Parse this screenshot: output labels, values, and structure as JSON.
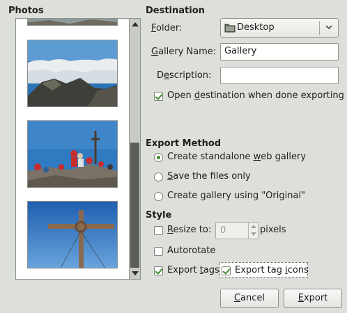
{
  "photos": {
    "title": "Photos",
    "thumbnails": [
      {
        "name": "mountain-trail-partial",
        "colors": {
          "sky": "#8e9a9a",
          "ground": "#6f6a5e"
        }
      },
      {
        "name": "sea-of-clouds",
        "colors": {
          "sky": "#2c73b6",
          "cloud": "#e9edf0",
          "mountain": "#3d3f38"
        }
      },
      {
        "name": "summit-group",
        "colors": {
          "sky": "#2f7ac1",
          "ground": "#7a7267",
          "people": "#c62c2c"
        }
      },
      {
        "name": "summit-cross",
        "colors": {
          "sky": "#3373bf",
          "cross": "#8a6a4e"
        }
      }
    ]
  },
  "destination": {
    "title": "Destination",
    "folder_label": "Folder:",
    "folder_value": "Desktop",
    "gallery_name_label": "Gallery Name:",
    "gallery_name_value": "Gallery",
    "description_label": "Description:",
    "description_value": "",
    "open_destination_label": "Open destination when done exporting",
    "open_destination_checked": true
  },
  "export_method": {
    "title": "Export Method",
    "options": [
      {
        "label": "Create standalone web gallery",
        "selected": true
      },
      {
        "label": "Save the files only",
        "selected": false
      },
      {
        "label": "Create gallery using \"Original\"",
        "selected": false
      }
    ]
  },
  "style": {
    "title": "Style",
    "resize_label": "Resize to:",
    "resize_checked": false,
    "resize_value": "0",
    "resize_unit": "pixels",
    "autorotate_label": "Autorotate",
    "autorotate_checked": false,
    "export_tags_label": "Export tags",
    "export_tags_checked": true,
    "export_tag_icons_label": "Export tag icons",
    "export_tag_icons_checked": true
  },
  "buttons": {
    "cancel": "Cancel",
    "export": "Export"
  },
  "colors": {
    "background": "#dcdfda",
    "check_green": "#3c8a2e"
  },
  "icons": {
    "folder": "folder-icon",
    "combo_arrow": "chevron-down-icon",
    "scroll_up": "arrow-up-icon",
    "scroll_down": "arrow-down-icon"
  }
}
